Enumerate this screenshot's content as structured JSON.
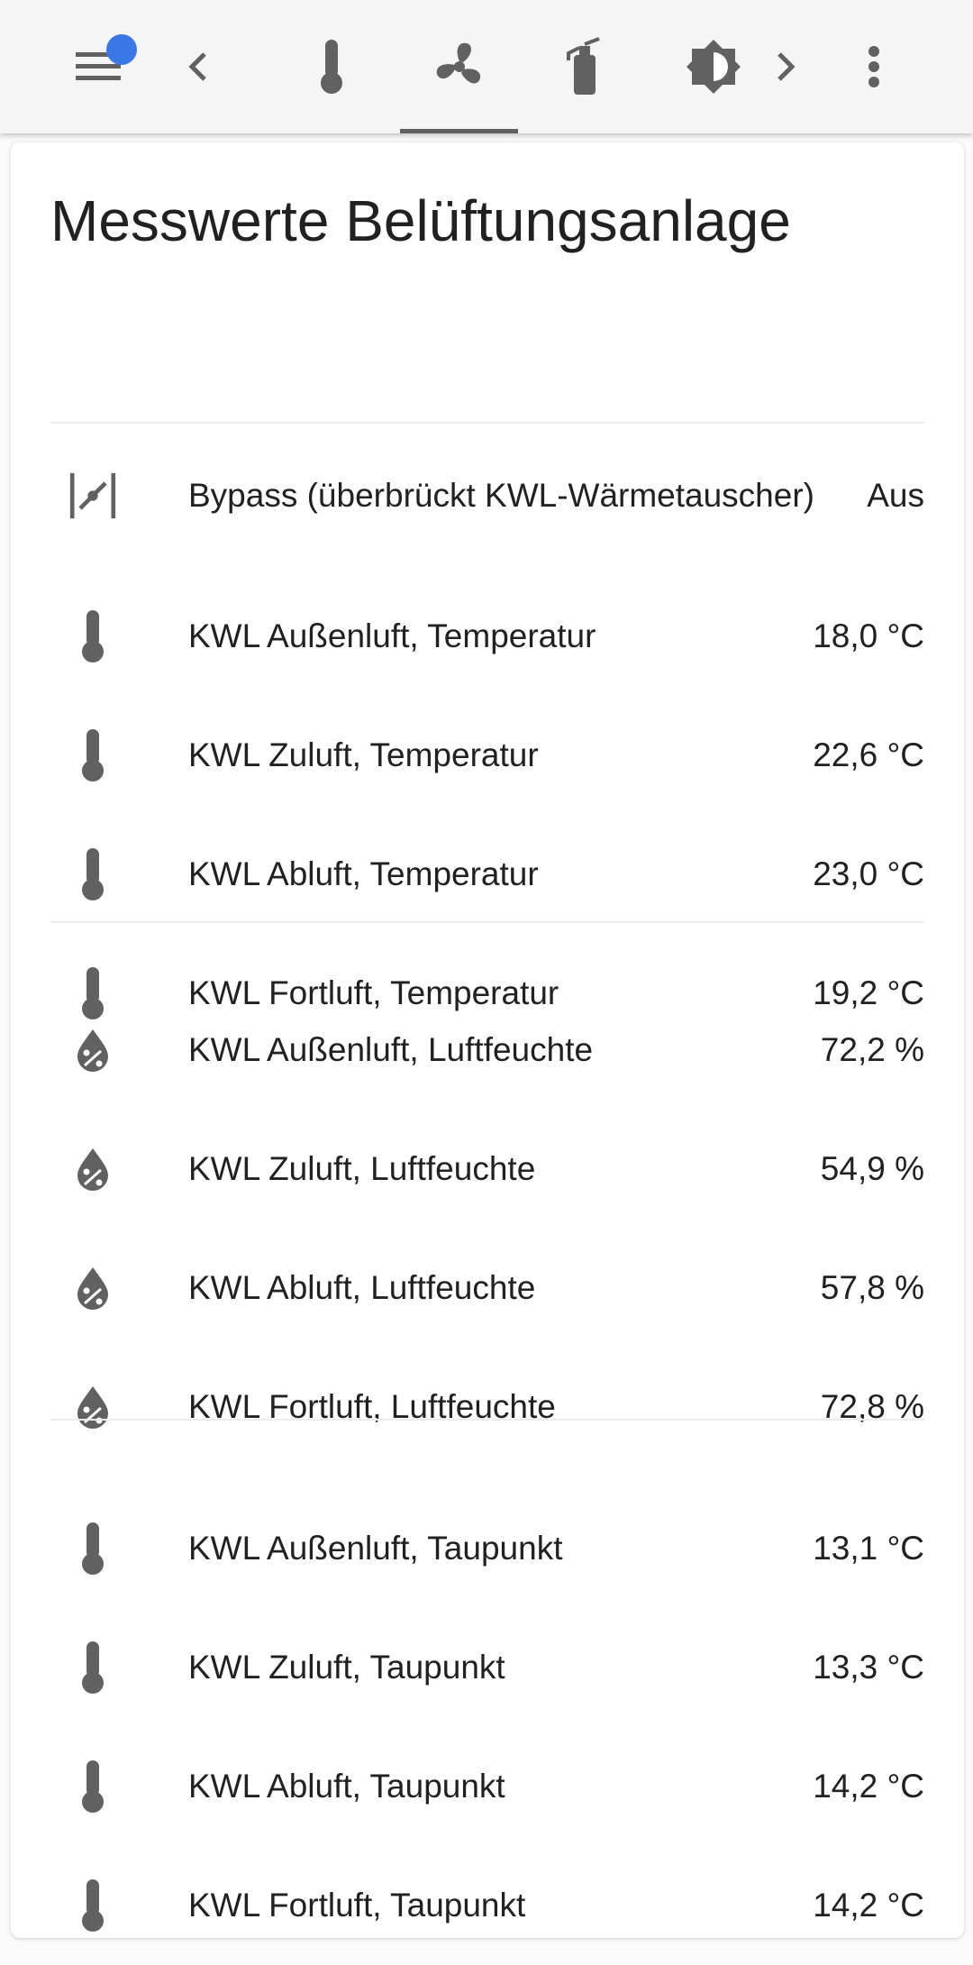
{
  "colors": {
    "icon": "#616161",
    "badge": "#3b78e7",
    "text": "#212121",
    "card_bg": "#ffffff",
    "toolbar_bg": "#f5f5f5"
  },
  "toolbar": {
    "tabs": [
      {
        "name": "menu-icon"
      },
      {
        "name": "chevron-left-icon"
      },
      {
        "name": "thermometer-icon"
      },
      {
        "name": "fan-icon",
        "active": true
      },
      {
        "name": "fire-extinguisher-icon"
      },
      {
        "name": "brightness-icon"
      },
      {
        "name": "chevron-right-icon"
      },
      {
        "name": "more-vert-icon"
      }
    ]
  },
  "card": {
    "title": "Messwerte Belüftungsanlage",
    "bypass": {
      "label": "Bypass (überbrückt KWL-Wärmetauscher)",
      "value": "Aus",
      "icon": "valve-icon"
    },
    "temperature": [
      {
        "label": "KWL Außenluft, Temperatur",
        "value": "18,0 °C",
        "icon": "thermometer-icon"
      },
      {
        "label": "KWL Zuluft, Temperatur",
        "value": "22,6 °C",
        "icon": "thermometer-icon"
      },
      {
        "label": "KWL Abluft, Temperatur",
        "value": "23,0 °C",
        "icon": "thermometer-icon"
      },
      {
        "label": "KWL Fortluft, Temperatur",
        "value": "19,2 °C",
        "icon": "thermometer-icon"
      }
    ],
    "humidity": [
      {
        "label": "KWL Außenluft, Luftfeuchte",
        "value": "72,2 %",
        "icon": "water-percent-icon"
      },
      {
        "label": "KWL Zuluft, Luftfeuchte",
        "value": "54,9 %",
        "icon": "water-percent-icon"
      },
      {
        "label": "KWL Abluft, Luftfeuchte",
        "value": "57,8 %",
        "icon": "water-percent-icon"
      },
      {
        "label": "KWL Fortluft, Luftfeuchte",
        "value": "72,8 %",
        "icon": "water-percent-icon"
      }
    ],
    "dewpoint": [
      {
        "label": "KWL Außenluft, Taupunkt",
        "value": "13,1 °C",
        "icon": "thermometer-icon"
      },
      {
        "label": "KWL Zuluft, Taupunkt",
        "value": "13,3 °C",
        "icon": "thermometer-icon"
      },
      {
        "label": "KWL Abluft, Taupunkt",
        "value": "14,2 °C",
        "icon": "thermometer-icon"
      },
      {
        "label": "KWL Fortluft, Taupunkt",
        "value": "14,2 °C",
        "icon": "thermometer-icon"
      }
    ]
  }
}
